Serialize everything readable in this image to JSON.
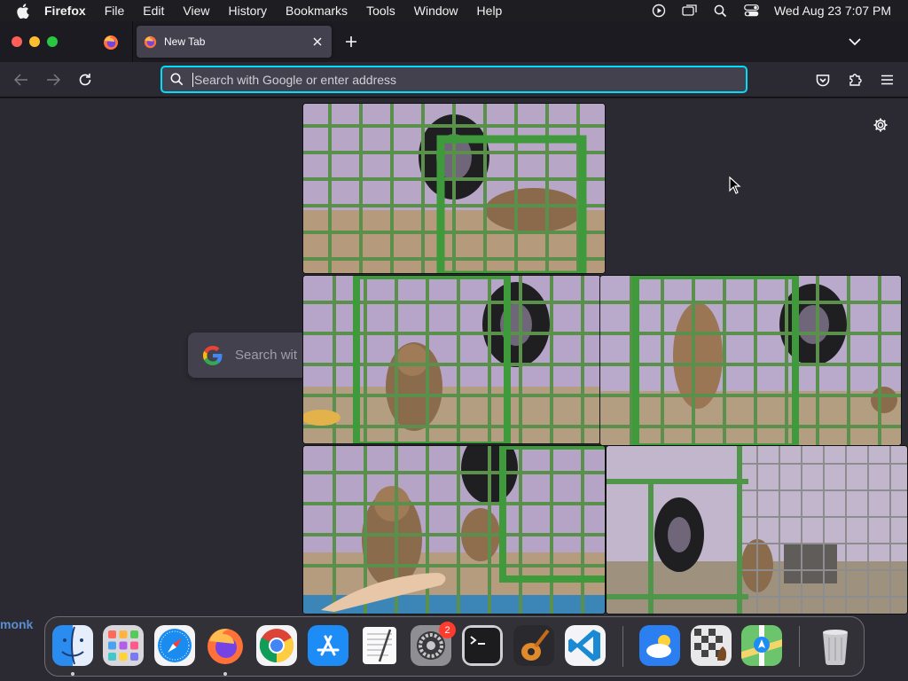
{
  "menubar": {
    "app_name": "Firefox",
    "menus": [
      "File",
      "Edit",
      "View",
      "History",
      "Bookmarks",
      "Tools",
      "Window",
      "Help"
    ],
    "clock": "Wed Aug 23  7:07 PM",
    "status_icons": [
      "screen-record-icon",
      "window-switch-icon",
      "spotlight-search-icon",
      "control-center-icon"
    ]
  },
  "tabs": {
    "active_tab_title": "New Tab"
  },
  "navbar": {
    "url_placeholder": "Search with Google or enter address"
  },
  "content": {
    "google_search_text": "Search wit",
    "side_label": "monk"
  },
  "dock": {
    "apps": [
      "Finder",
      "Launchpad",
      "Safari",
      "Firefox",
      "Chrome",
      "App Store",
      "TextEdit",
      "System Settings",
      "Terminal",
      "GarageBand",
      "VS Code",
      "Weather",
      "Chess",
      "Maps",
      "Trash"
    ],
    "settings_badge": "2"
  },
  "colors": {
    "accent_focus": "#00ddff",
    "toolbar": "#2b2a33",
    "tab_active": "#42414d"
  }
}
